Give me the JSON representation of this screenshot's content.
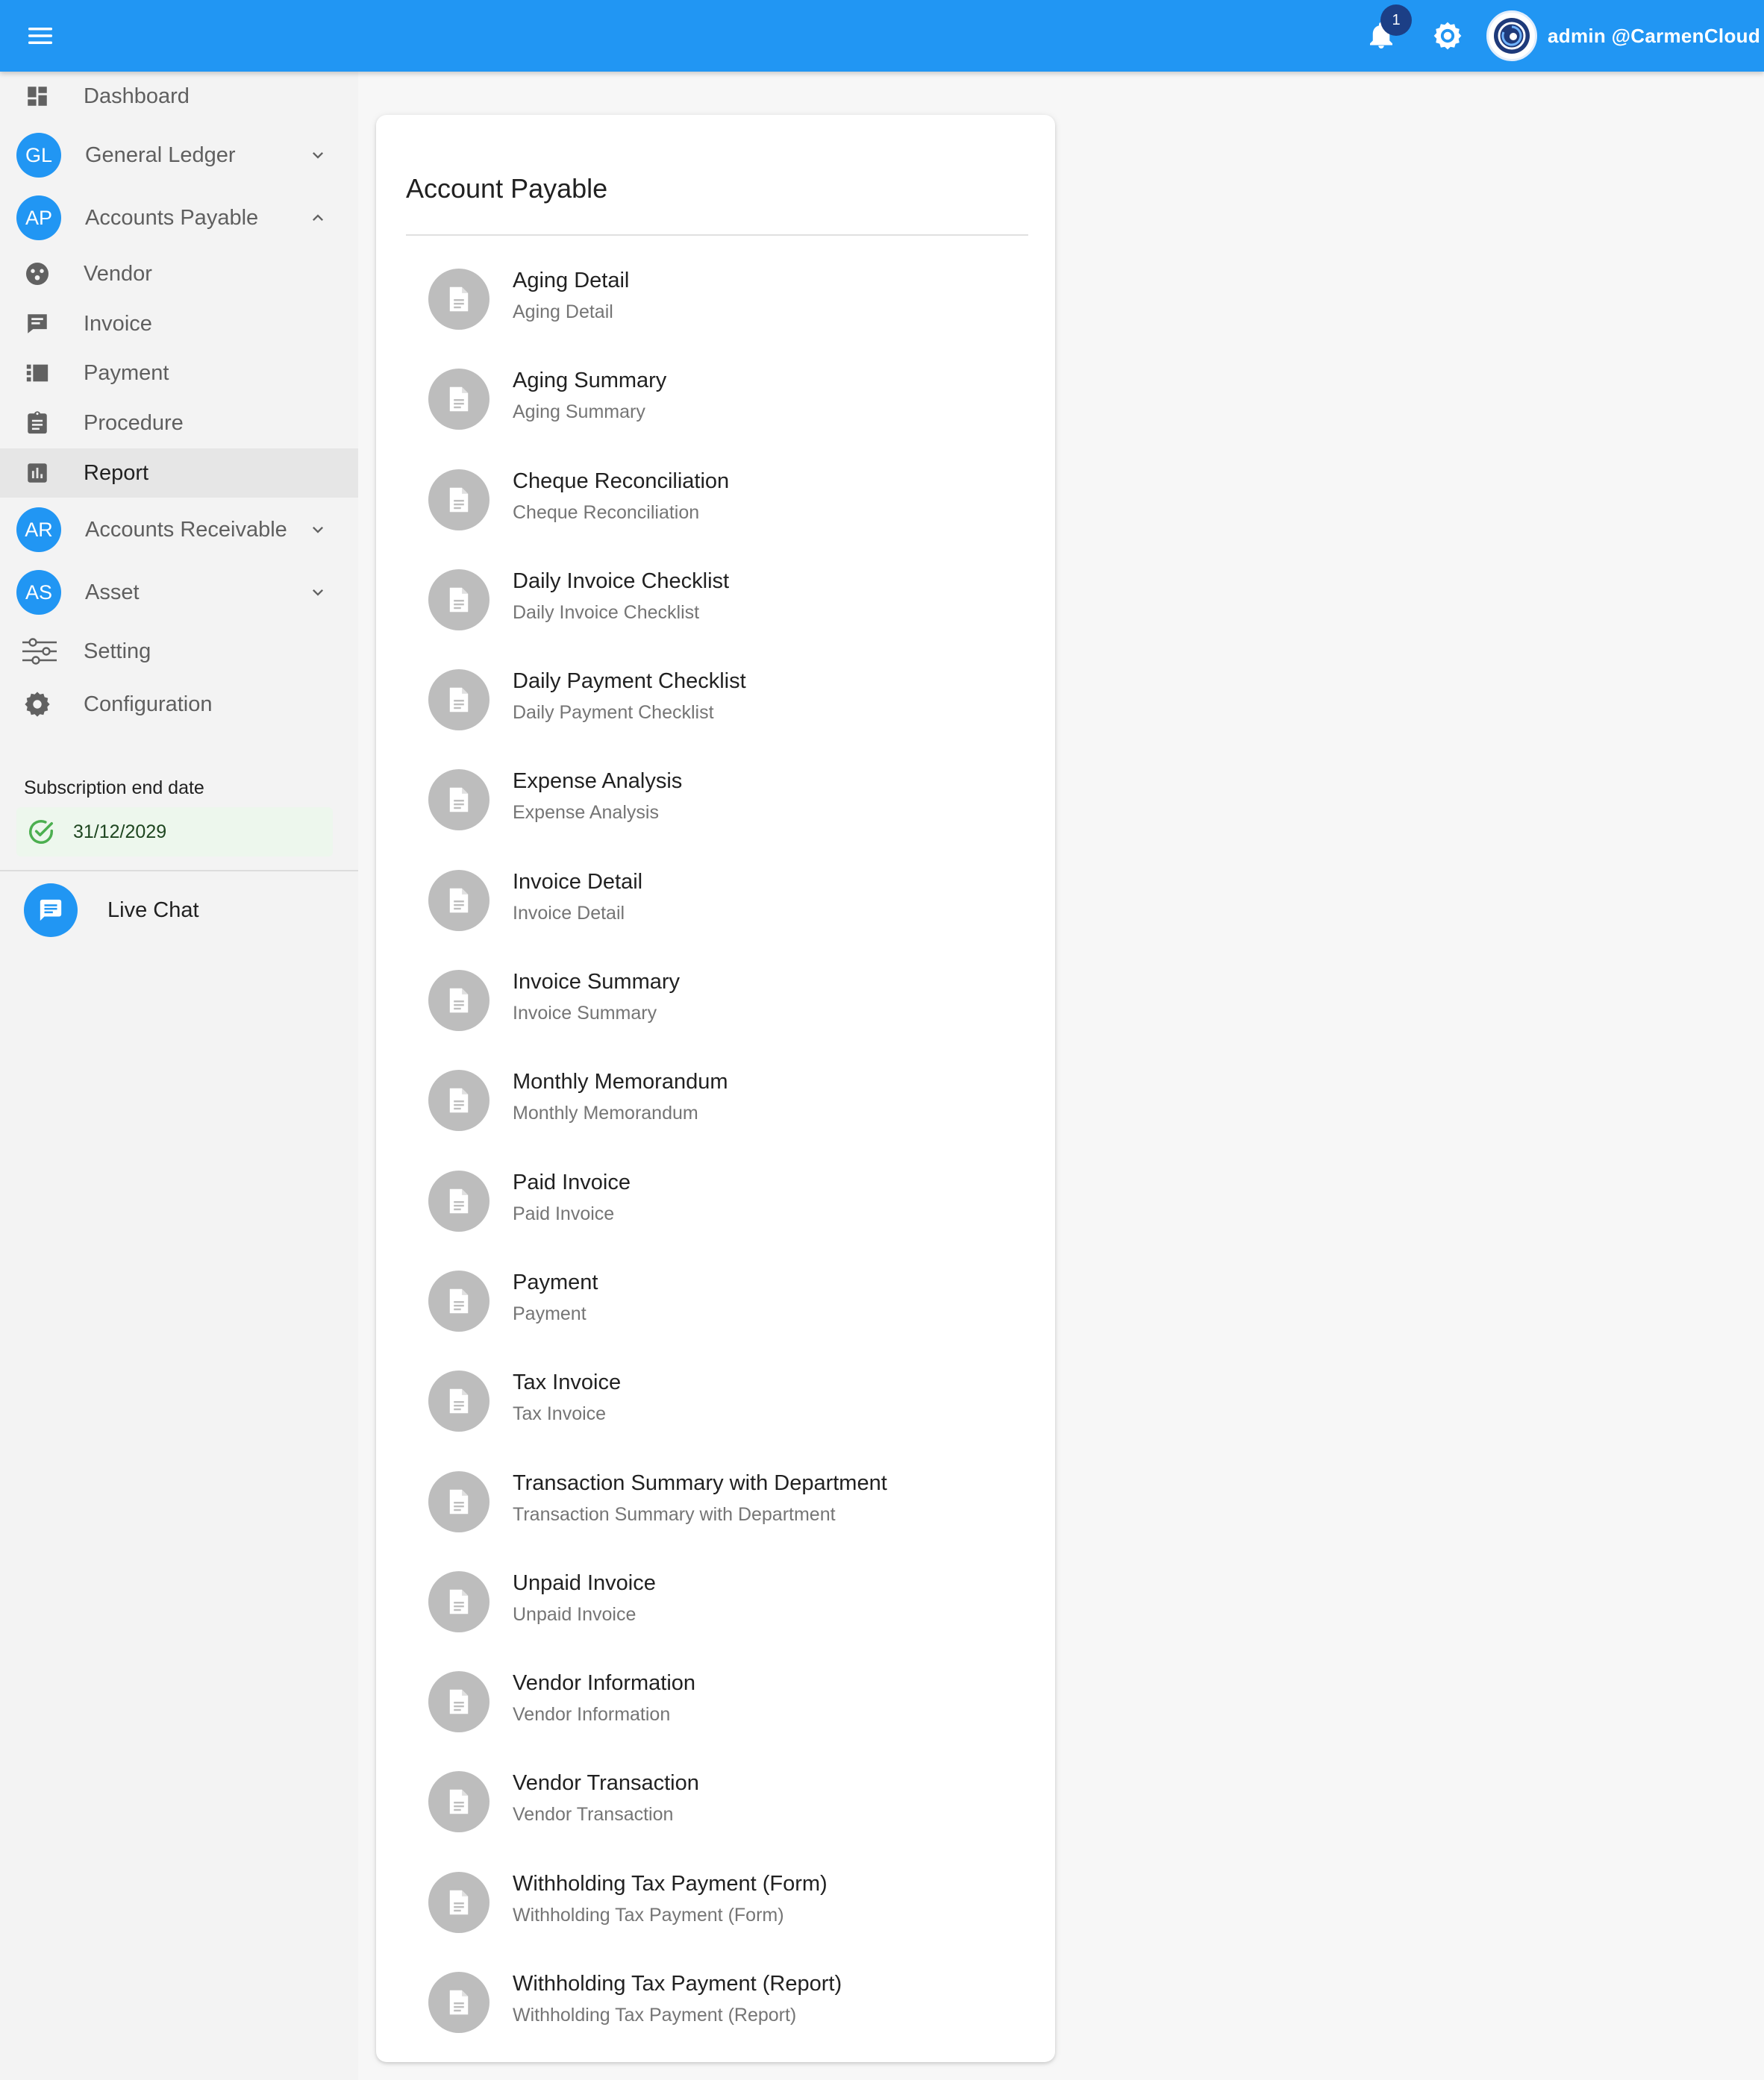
{
  "header": {
    "notification_count": "1",
    "user_name": "admin @CarmenCloud",
    "bar_color": "#2196f3"
  },
  "sidebar": {
    "items": [
      {
        "label": "Dashboard",
        "icon": "dashboard-icon"
      },
      {
        "label": "General Ledger",
        "badge": "GL",
        "expanded": false
      },
      {
        "label": "Accounts Payable",
        "badge": "AP",
        "expanded": true
      },
      {
        "label": "Vendor",
        "icon": "vendor-icon"
      },
      {
        "label": "Invoice",
        "icon": "invoice-icon"
      },
      {
        "label": "Payment",
        "icon": "payment-icon"
      },
      {
        "label": "Procedure",
        "icon": "clipboard-icon"
      },
      {
        "label": "Report",
        "icon": "chart-icon",
        "active": true
      },
      {
        "label": "Accounts Receivable",
        "badge": "AR",
        "expanded": false
      },
      {
        "label": "Asset",
        "badge": "AS",
        "expanded": false
      },
      {
        "label": "Setting",
        "icon": "sliders-icon"
      },
      {
        "label": "Configuration",
        "icon": "gear-icon"
      }
    ],
    "subscription": {
      "title": "Subscription end date",
      "date": "31/12/2029",
      "status_color": "#4caf50"
    },
    "live_chat": "Live Chat"
  },
  "main": {
    "title": "Account Payable",
    "reports": [
      {
        "primary": "Aging Detail",
        "secondary": "Aging Detail"
      },
      {
        "primary": "Aging Summary",
        "secondary": "Aging Summary"
      },
      {
        "primary": "Cheque Reconciliation",
        "secondary": "Cheque Reconciliation"
      },
      {
        "primary": "Daily Invoice Checklist",
        "secondary": "Daily Invoice Checklist"
      },
      {
        "primary": "Daily Payment Checklist",
        "secondary": "Daily Payment Checklist"
      },
      {
        "primary": "Expense Analysis",
        "secondary": "Expense Analysis"
      },
      {
        "primary": "Invoice Detail",
        "secondary": "Invoice Detail"
      },
      {
        "primary": "Invoice Summary",
        "secondary": "Invoice Summary"
      },
      {
        "primary": "Monthly Memorandum",
        "secondary": "Monthly Memorandum"
      },
      {
        "primary": "Paid Invoice",
        "secondary": "Paid Invoice"
      },
      {
        "primary": "Payment",
        "secondary": "Payment"
      },
      {
        "primary": "Tax Invoice",
        "secondary": "Tax Invoice"
      },
      {
        "primary": "Transaction Summary with Department",
        "secondary": "Transaction Summary with Department"
      },
      {
        "primary": "Unpaid Invoice",
        "secondary": "Unpaid Invoice"
      },
      {
        "primary": "Vendor Information",
        "secondary": "Vendor Information"
      },
      {
        "primary": "Vendor Transaction",
        "secondary": "Vendor Transaction"
      },
      {
        "primary": "Withholding Tax Payment (Form)",
        "secondary": "Withholding Tax Payment (Form)"
      },
      {
        "primary": "Withholding Tax Payment (Report)",
        "secondary": "Withholding Tax Payment (Report)"
      }
    ]
  }
}
